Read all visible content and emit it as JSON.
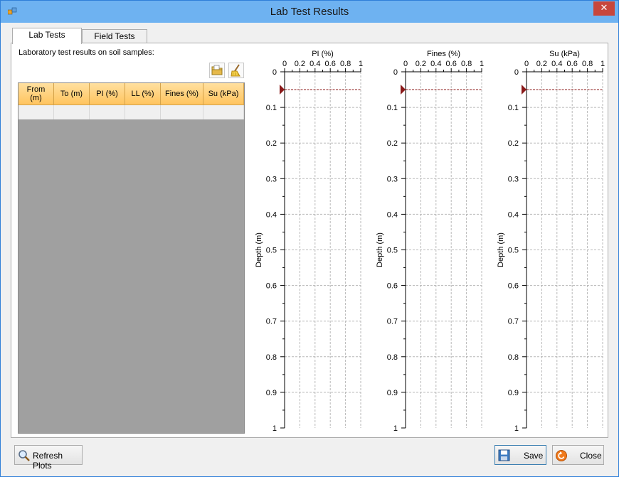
{
  "window": {
    "title": "Lab Test Results",
    "close_glyph": "✕"
  },
  "tabs": [
    {
      "label": "Lab Tests",
      "active": true
    },
    {
      "label": "Field Tests",
      "active": false
    }
  ],
  "lab": {
    "description": "Laboratory test results on soil samples:",
    "toolbar": {
      "open_icon": "open-folder-icon",
      "clear_icon": "broom-icon"
    },
    "columns": [
      "From (m)",
      "To (m)",
      "PI (%)",
      "LL (%)",
      "Fines (%)",
      "Su (kPa)"
    ]
  },
  "plots": [
    {
      "title": "PI (%)",
      "ylabel": "Depth (m)",
      "xticks": [
        "0",
        "0.2",
        "0.4",
        "0.6",
        "0.8",
        "1"
      ],
      "yticks": [
        "0",
        "0.1",
        "0.2",
        "0.3",
        "0.4",
        "0.5",
        "0.6",
        "0.7",
        "0.8",
        "0.9",
        "1"
      ],
      "xlim": [
        0,
        1
      ],
      "ylim": [
        0,
        1
      ],
      "marker_depth": 0.05
    },
    {
      "title": "Fines (%)",
      "ylabel": "Depth (m)",
      "xticks": [
        "0",
        "0.2",
        "0.4",
        "0.6",
        "0.8",
        "1"
      ],
      "yticks": [
        "0",
        "0.1",
        "0.2",
        "0.3",
        "0.4",
        "0.5",
        "0.6",
        "0.7",
        "0.8",
        "0.9",
        "1"
      ],
      "xlim": [
        0,
        1
      ],
      "ylim": [
        0,
        1
      ],
      "marker_depth": 0.05
    },
    {
      "title": "Su (kPa)",
      "ylabel": "Depth (m)",
      "xticks": [
        "0",
        "0.2",
        "0.4",
        "0.6",
        "0.8",
        "1"
      ],
      "yticks": [
        "0",
        "0.1",
        "0.2",
        "0.3",
        "0.4",
        "0.5",
        "0.6",
        "0.7",
        "0.8",
        "0.9",
        "1"
      ],
      "xlim": [
        0,
        1
      ],
      "ylim": [
        0,
        1
      ],
      "marker_depth": 0.05
    }
  ],
  "buttons": {
    "refresh": "Refresh Plots",
    "save": "Save",
    "close": "Close"
  },
  "colors": {
    "marker": "#8b1a1a",
    "header_orange": "#ffc45e",
    "close_icon": "#e8650a"
  }
}
